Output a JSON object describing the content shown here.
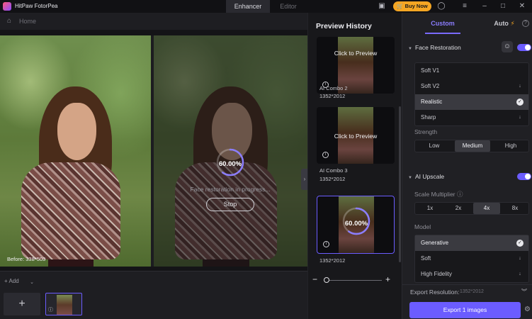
{
  "app": {
    "title": "HitPaw FotorPea",
    "tabs": [
      {
        "label": "Enhancer",
        "active": true
      },
      {
        "label": "Editor",
        "active": false
      }
    ],
    "buy_now": "Buy Now",
    "icons": {
      "logo": "app-logo-icon",
      "chat": "chat-icon",
      "cart": "cart-icon",
      "account": "account-icon",
      "menu": "menu-icon",
      "minimize": "minimize-icon",
      "maximize": "maximize-icon",
      "close": "close-icon"
    }
  },
  "breadcrumb": {
    "home": "Home"
  },
  "canvas": {
    "before_label": "Before: 338*503",
    "progress": {
      "percent_text": "60.00%",
      "fraction": 0.6,
      "status": "Face restoration in progress...",
      "stop_label": "Stop"
    }
  },
  "bottom": {
    "add_label": "Add",
    "add_tile": "+"
  },
  "history": {
    "title": "Preview History",
    "items": [
      {
        "cta": "Click to Preview",
        "name": "AI Combo 2",
        "size": "1352*2012"
      },
      {
        "cta": "Click to Preview",
        "name": "AI Combo 3",
        "size": "1352*2012"
      },
      {
        "percent_text": "60.00%",
        "fraction": 0.6,
        "size": "1352*2012"
      }
    ],
    "zoom": {
      "minus": "−",
      "plus": "+",
      "level": 0.0
    }
  },
  "settings": {
    "tabs": {
      "custom": "Custom",
      "auto": "Auto"
    },
    "face_restoration": {
      "title": "Face Restoration",
      "enabled": true,
      "options": [
        {
          "label": "Soft V1",
          "state": "none"
        },
        {
          "label": "Soft V2",
          "state": "download"
        },
        {
          "label": "Realistic",
          "state": "selected"
        },
        {
          "label": "Sharp",
          "state": "download"
        }
      ],
      "strength_label": "Strength",
      "strength_options": [
        "Low",
        "Medium",
        "High"
      ],
      "strength_selected": "Medium"
    },
    "ai_upscale": {
      "title": "AI Upscale",
      "enabled": true,
      "scale_label": "Scale Multiplier",
      "scale_options": [
        "1x",
        "2x",
        "4x",
        "8x"
      ],
      "scale_selected": "4x",
      "model_label": "Model",
      "models": [
        {
          "label": "Generative",
          "state": "selected"
        },
        {
          "label": "Soft",
          "state": "download"
        },
        {
          "label": "High Fidelity",
          "state": "download"
        }
      ]
    },
    "export_resolution_label": "Export Resolution:",
    "export_resolution_value": "1352*2012",
    "export_button": "Export 1 images"
  },
  "colors": {
    "accent": "#6b5cff",
    "buy_now": "#f5a623"
  }
}
